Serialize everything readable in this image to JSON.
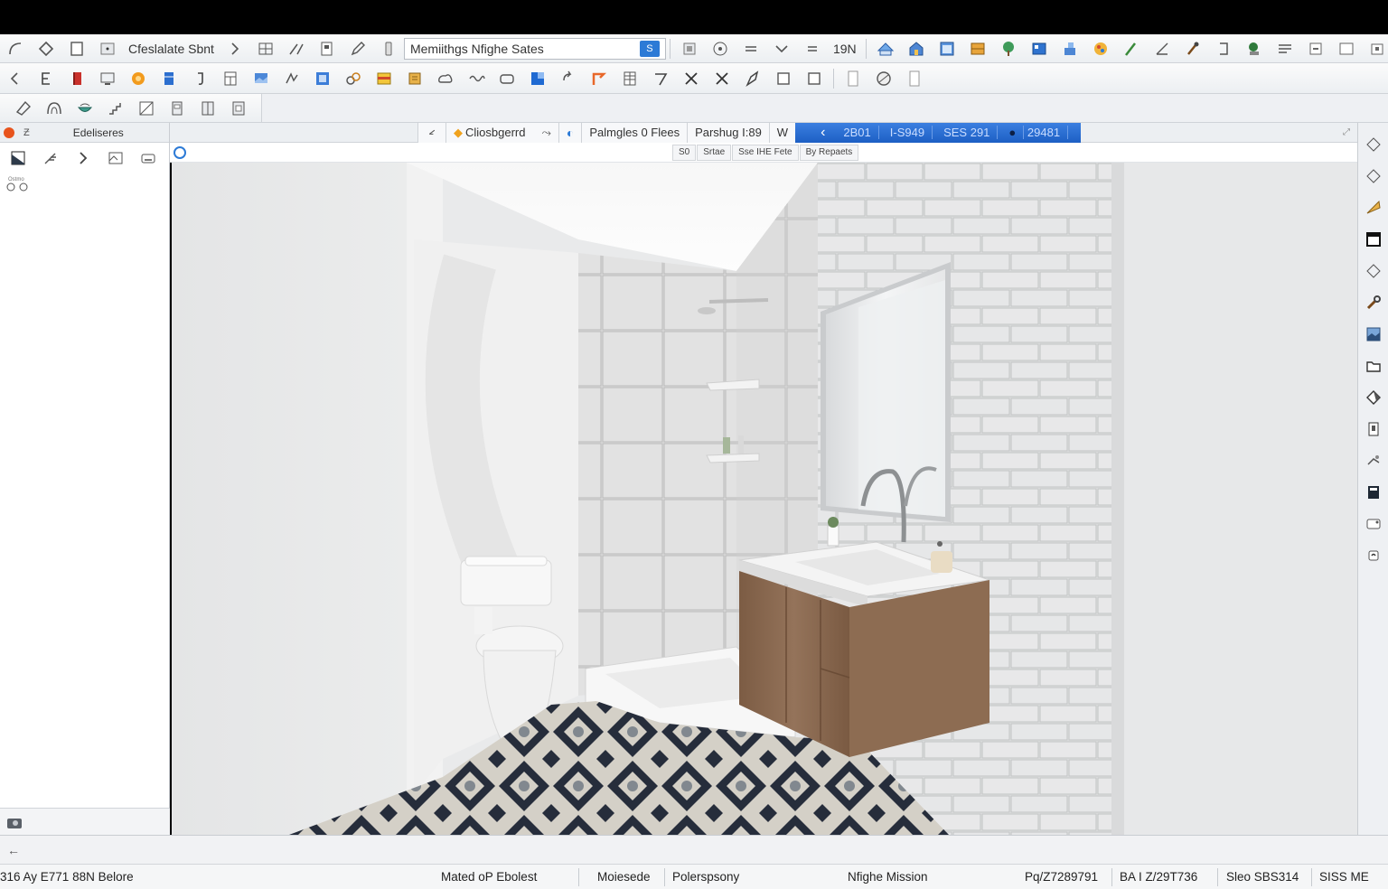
{
  "toolbar": {
    "style_label": "Cfeslalate Sbnt",
    "search_value": "Memiithgs Nfighe Sates",
    "search_btn": "S",
    "zoom_label": "19N"
  },
  "left_panel": {
    "header_label": "Edeliseres",
    "small_label": "Ostmo"
  },
  "view_tabs": {
    "tab1": "Cliosbgerrd",
    "tab2": "Palmgles 0 Flees",
    "tab3": "Parshug I:89",
    "tab4": "W",
    "blue": [
      "2B01",
      "I-S949",
      "SES 291",
      "29481"
    ]
  },
  "sub_tabs": [
    "S0",
    "Srtae",
    "Sse IHE Fete",
    "By Repaets"
  ],
  "command_line": {
    "prompt": "←"
  },
  "status": {
    "coords": "316 Ay E771 88N Belore",
    "s1": "Mated oP Ebolest",
    "s2": "Moiesede",
    "s3": "Polerspsony",
    "s4": "Nfighe Mission",
    "s5": "Pq/Z7289791",
    "s6": "BA I Z/29T736",
    "s7": "Sleo SBS314",
    "s8": "SISS ME"
  },
  "colors": {
    "accent": "#2c7ad6",
    "tab_blue": "#1d5fc4",
    "cabinet": "#8a6a50",
    "floor_dark": "#2a3140"
  }
}
